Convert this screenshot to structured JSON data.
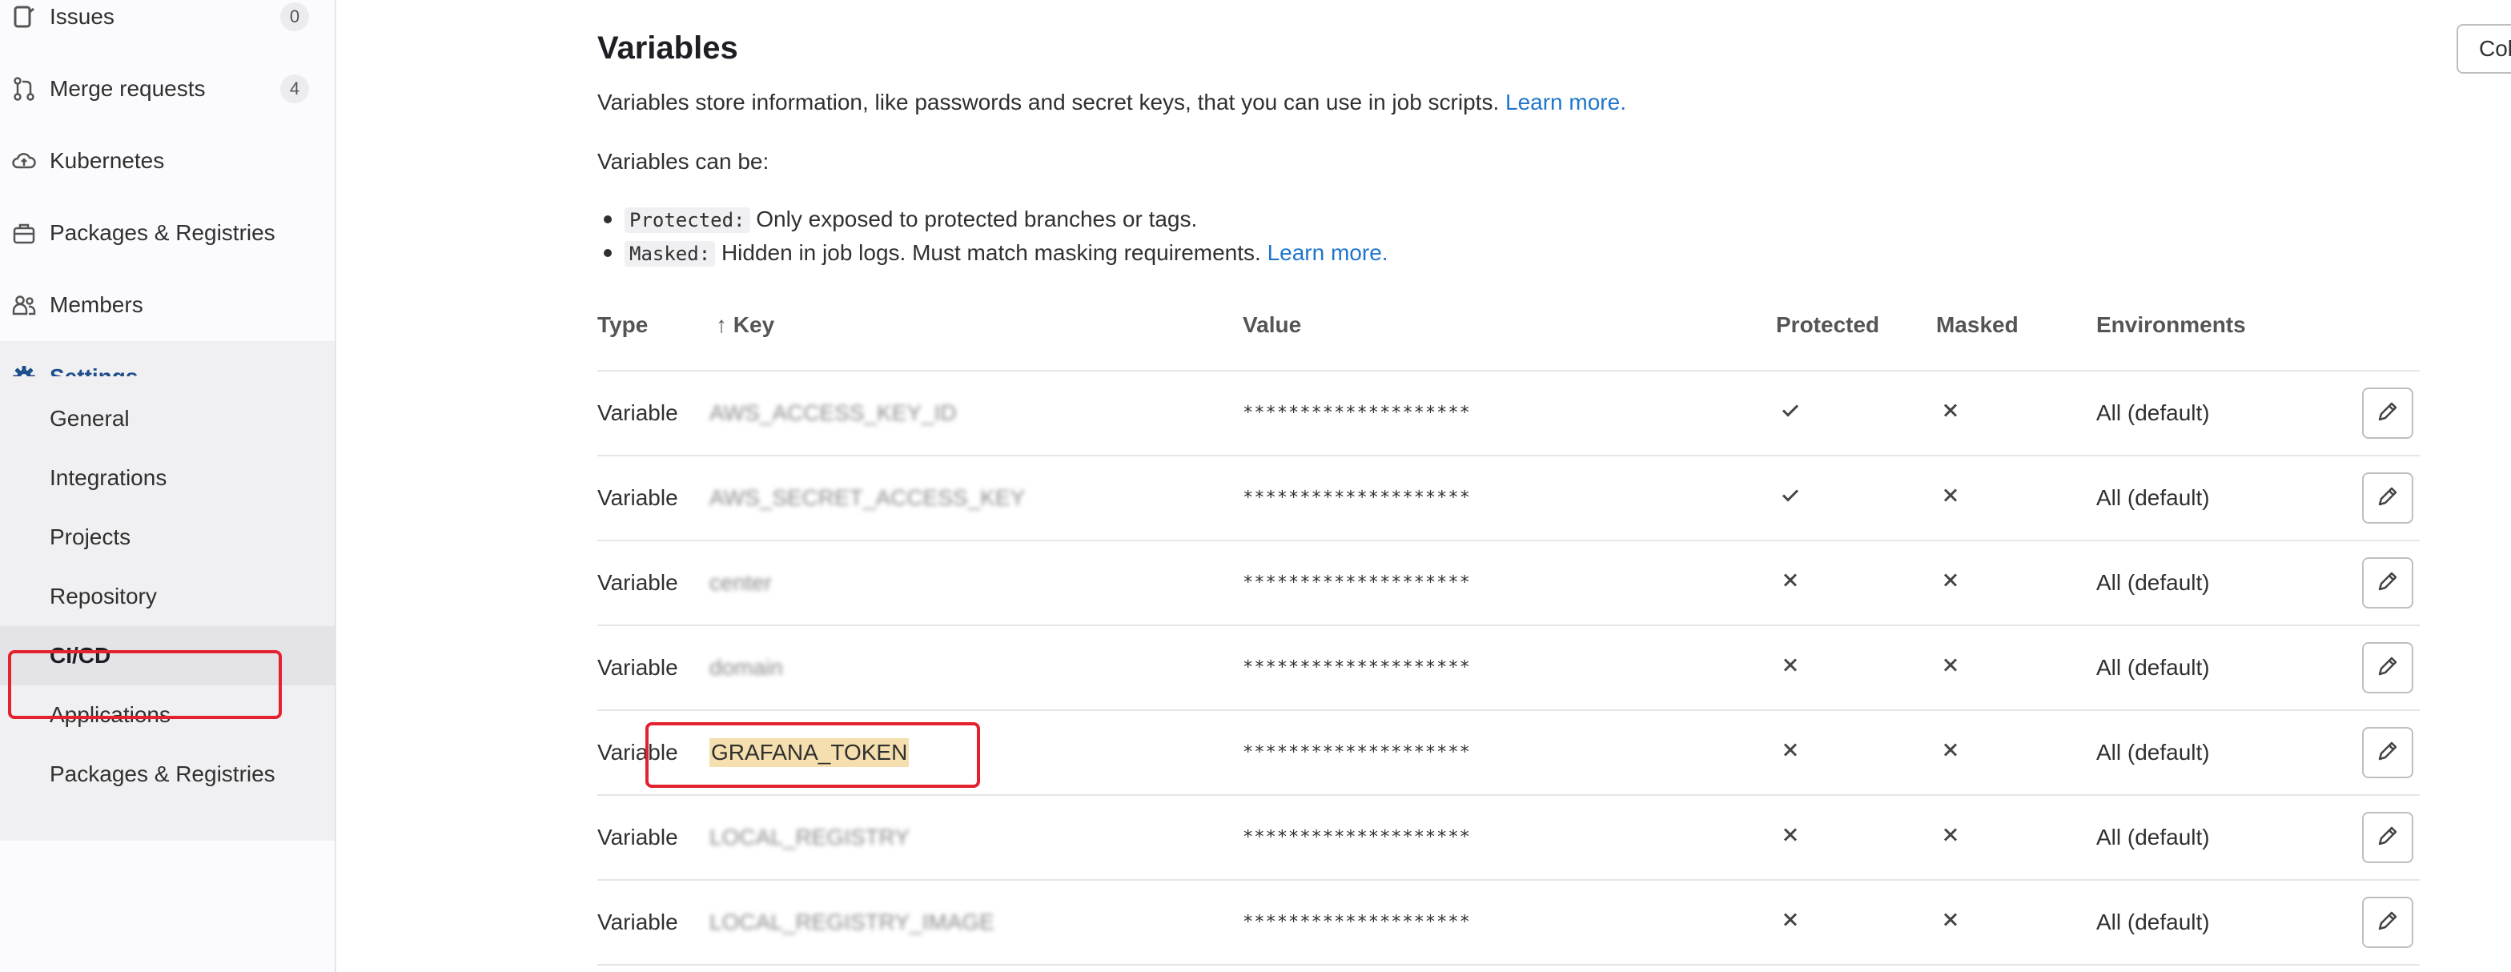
{
  "sidebar": {
    "items": [
      {
        "label": "Issues",
        "count": "0",
        "icon": "issues-icon"
      },
      {
        "label": "Merge requests",
        "count": "4",
        "icon": "merge-request-icon"
      },
      {
        "label": "Kubernetes",
        "icon": "cloud-icon"
      },
      {
        "label": "Packages & Registries",
        "icon": "package-icon"
      },
      {
        "label": "Members",
        "icon": "users-icon"
      },
      {
        "label": "Settings",
        "icon": "gear-icon"
      }
    ],
    "settings_submenu": [
      {
        "label": "General"
      },
      {
        "label": "Integrations"
      },
      {
        "label": "Projects"
      },
      {
        "label": "Repository"
      },
      {
        "label": "CI/CD",
        "active": true
      },
      {
        "label": "Applications"
      },
      {
        "label": "Packages & Registries"
      }
    ]
  },
  "main": {
    "collapse_button": "Collapse",
    "title": "Variables",
    "intro": "Variables store information, like passwords and secret keys, that you can use in job scripts.",
    "learn_more": "Learn more.",
    "can_be": "Variables can be:",
    "bullets": [
      {
        "code": "Protected:",
        "text": "Only exposed to protected branches or tags.",
        "link": ""
      },
      {
        "code": "Masked:",
        "text": "Hidden in job logs. Must match masking requirements.",
        "link": "Learn more."
      }
    ],
    "table": {
      "headers": {
        "type": "Type",
        "key": "↑ Key",
        "value": "Value",
        "protected": "Protected",
        "masked": "Masked",
        "environments": "Environments"
      },
      "rows": [
        {
          "type": "Variable",
          "key": "AWS_ACCESS_KEY_ID",
          "blurred": true,
          "value": "********************",
          "protected": true,
          "masked": false,
          "environments": "All (default)"
        },
        {
          "type": "Variable",
          "key": "AWS_SECRET_ACCESS_KEY",
          "blurred": true,
          "value": "********************",
          "protected": true,
          "masked": false,
          "environments": "All (default)"
        },
        {
          "type": "Variable",
          "key": "center",
          "blurred": true,
          "value": "********************",
          "protected": false,
          "masked": false,
          "environments": "All (default)"
        },
        {
          "type": "Variable",
          "key": "domain",
          "blurred": true,
          "value": "********************",
          "protected": false,
          "masked": false,
          "environments": "All (default)"
        },
        {
          "type": "Variable",
          "key": "GRAFANA_TOKEN",
          "blurred": false,
          "highlighted": true,
          "value": "********************",
          "protected": false,
          "masked": false,
          "environments": "All (default)"
        },
        {
          "type": "Variable",
          "key": "LOCAL_REGISTRY",
          "blurred": true,
          "value": "********************",
          "protected": false,
          "masked": false,
          "environments": "All (default)"
        },
        {
          "type": "Variable",
          "key": "LOCAL_REGISTRY_IMAGE",
          "blurred": true,
          "value": "********************",
          "protected": false,
          "masked": false,
          "environments": "All (default)"
        }
      ]
    }
  },
  "colors": {
    "link": "#1f75cb",
    "highlight_border": "#e4222e",
    "key_highlight": "#f5dfae"
  }
}
